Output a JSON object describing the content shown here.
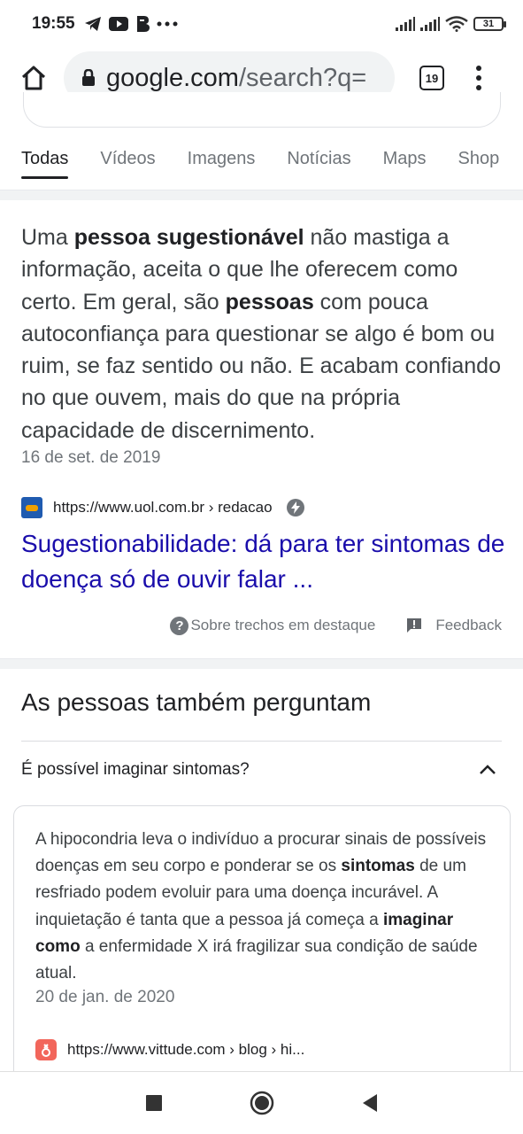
{
  "status_bar": {
    "time": "19:55",
    "app_icons": [
      "telegram-icon",
      "youtube-icon",
      "b-app-icon",
      "more-dots-icon"
    ],
    "battery": "31",
    "indicators": [
      "signal-icon",
      "signal-icon",
      "wifi-icon"
    ]
  },
  "browser": {
    "url_host": "google.com",
    "url_path": "/search?q=",
    "tab_count": "19"
  },
  "search_tabs": [
    {
      "label": "Todas",
      "active": true
    },
    {
      "label": "Vídeos",
      "active": false
    },
    {
      "label": "Imagens",
      "active": false
    },
    {
      "label": "Notícias",
      "active": false
    },
    {
      "label": "Maps",
      "active": false
    },
    {
      "label": "Shop",
      "active": false
    }
  ],
  "featured_snippet": {
    "segments": [
      {
        "text": "Uma ",
        "bold": false
      },
      {
        "text": "pessoa sugestionável",
        "bold": true
      },
      {
        "text": " não mastiga a informação, aceita o que lhe oferecem como certo. Em geral, são ",
        "bold": false
      },
      {
        "text": "pessoas",
        "bold": true
      },
      {
        "text": " com pouca autoconfiança para questionar se algo é bom ou ruim, se faz sentido ou não. E acabam confiando no que ouvem, mais do que na própria capacidade de discernimento.",
        "bold": false
      }
    ],
    "date": "16 de set. de 2019",
    "source_url": "https://www.uol.com.br › redacao",
    "title": "Sugestionabilidade: dá para ter sintomas de doença só de ouvir falar ...",
    "about_label": "Sobre trechos em destaque",
    "feedback_label": "Feedback"
  },
  "people_also_ask": {
    "title": "As pessoas também perguntam",
    "question": "É possível imaginar sintomas?",
    "expanded": true,
    "answer_segments": [
      {
        "text": "A hipocondria leva o indivíduo a procurar sinais de possíveis doenças em seu corpo e ponderar se os ",
        "bold": false
      },
      {
        "text": "sintomas",
        "bold": true
      },
      {
        "text": " de um resfriado podem evoluir para uma doença incurável. A inquietação é tanta que a pessoa já começa a ",
        "bold": false
      },
      {
        "text": "imaginar como",
        "bold": true
      },
      {
        "text": " a enfermidade X irá fragilizar sua condição de saúde atual.",
        "bold": false
      }
    ],
    "date": "20 de jan. de 2020",
    "source_url": "https://www.vittude.com › blog › hi..."
  },
  "nav_bar": {
    "buttons": [
      "recent-apps-icon",
      "home-icon",
      "back-icon"
    ]
  }
}
